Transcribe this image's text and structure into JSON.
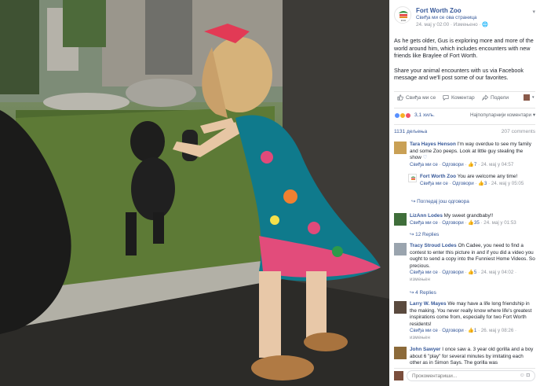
{
  "page": {
    "name": "Fort Worth Zoo",
    "like_page": "Свиђа ми се ова страница",
    "timestamp": "24. мај у 02:00 · Измењено · "
  },
  "post": {
    "paragraph1": "As he gets older, Gus is exploring more and more of the world around him, which includes encounters with new friends like Braylee of Fort Worth.",
    "paragraph2": "Share your animal encounters with us via Facebook message and we'll post some of our favorites."
  },
  "actions": {
    "like": "Свиђа ми се",
    "comment": "Коментар",
    "share": "Подели"
  },
  "reactions": {
    "count": "3,1 хиљ.",
    "sort": "Најпопуларнији коментари"
  },
  "counts": {
    "shares": "1131 дељења",
    "comments": "207 comments"
  },
  "comments": [
    {
      "name": "Tara Hayes Henson",
      "text": " I'm way overdue to see my family and some Zoo peeps. Look at little guy stealing the show ",
      "like": "Свиђа ми се",
      "reply": "Одговори",
      "likes": "7",
      "time": "24. мај у 04:57"
    },
    {
      "name": "Fort Worth Zoo",
      "text": " You are welcome any time!",
      "like": "Свиђа ми се",
      "reply": "Одговори",
      "likes": "3",
      "time": "24. мај у 05:05"
    },
    {
      "name": "LizAnn Lodes",
      "text": " My sweet grandbaby!!",
      "like": "Свиђа ми се",
      "reply": "Одговори",
      "likes": "35",
      "time": "24. мај у 01:53"
    },
    {
      "name": "Tracy Stroud Lodes",
      "text": " Oh Cadee, you need to find a contest to enter this picture in and if you did a video you ought to send a copy into the Funniest Home Videos. So precious.",
      "like": "Свиђа ми се",
      "reply": "Одговори",
      "likes": "5",
      "time": "24. мај у 04:02",
      "edited": "измењен"
    },
    {
      "name": "Larry W. Mayes",
      "text": " We may have a life long friendship in the making. You never really know where life's greatest inspirations come from, especially for two Fort Worth residents!",
      "like": "Свиђа ми се",
      "reply": "Одговори",
      "likes": "1",
      "time": "26. мај у 08:26",
      "edited": "измењен"
    },
    {
      "name": "John Sawyer",
      "text": " I once saw a. 3 year old gorilla and a boy about 6 \"play\" for several minutes by imitating each other as in Simon Says. The gorilla was"
    }
  ],
  "reply_links": {
    "hide": "Погледај још одговора",
    "replies_12": "12 Replies",
    "replies_4": "4 Replies"
  },
  "composer": {
    "placeholder": "Прокоментариши..."
  },
  "colors": {
    "fb_blue": "#365899",
    "meta_gray": "#90949c",
    "like_blue": "#5890ff",
    "haha_yellow": "#f7b125",
    "love_red": "#f25268"
  }
}
